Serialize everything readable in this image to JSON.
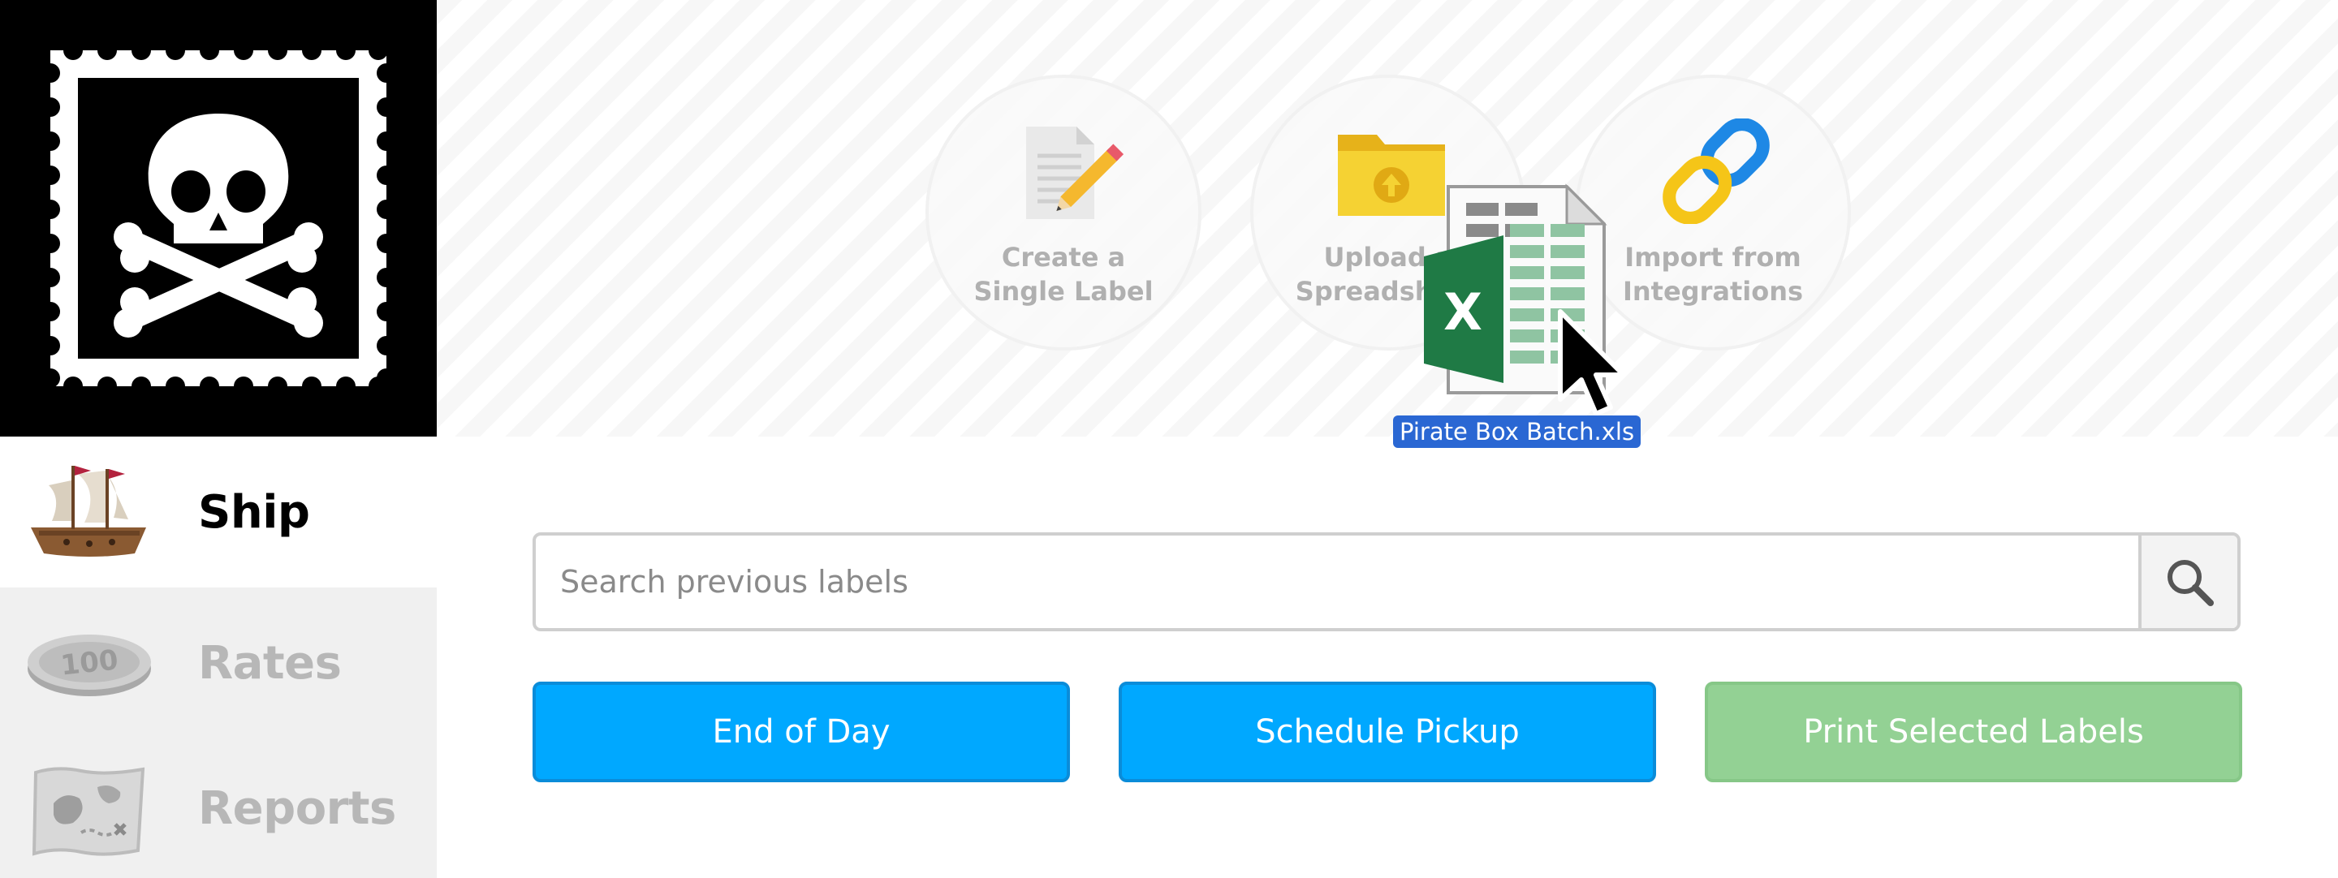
{
  "logo": {
    "icon": "skull-crossbones-stamp-icon"
  },
  "sidebar": {
    "items": [
      {
        "label": "Ship",
        "icon": "pirate-ship-icon",
        "active": true
      },
      {
        "label": "Rates",
        "icon": "coin-100-icon",
        "active": false
      },
      {
        "label": "Reports",
        "icon": "treasure-map-icon",
        "active": false
      }
    ]
  },
  "hero": {
    "options": [
      {
        "line1": "Create a",
        "line2": "Single Label",
        "icon": "document-pencil-icon"
      },
      {
        "line1": "Upload a",
        "line2": "Spreadsheet",
        "icon": "folder-upload-icon"
      },
      {
        "line1": "Import from",
        "line2": "Integrations",
        "icon": "chain-link-icon"
      }
    ],
    "drag": {
      "filename": "Pirate Box Batch.xls",
      "icon": "excel-file-icon"
    }
  },
  "search": {
    "placeholder": "Search previous labels",
    "icon": "magnifier-icon"
  },
  "actions": {
    "end_of_day": "End of Day",
    "schedule_pickup": "Schedule Pickup",
    "print_selected": "Print Selected Labels"
  },
  "colors": {
    "primary": "#00a8ff",
    "disabled_green": "#93d194",
    "drag_label": "#2a67d3"
  }
}
